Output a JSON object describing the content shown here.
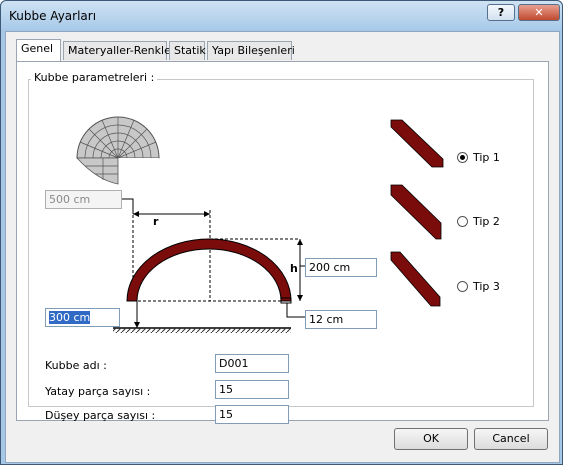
{
  "window": {
    "title": "Kubbe Ayarları",
    "help_label": "?",
    "close_label": "✕"
  },
  "tabs": [
    {
      "label": "Genel",
      "active": true
    },
    {
      "label": "Materyaller-Renkler"
    },
    {
      "label": "Statik"
    },
    {
      "label": "Yapı Bileşenleri"
    }
  ],
  "group": {
    "label": "Kubbe parametreleri :"
  },
  "fields": {
    "radius": {
      "value": "500 cm",
      "enabled": false
    },
    "base": {
      "value": "300 cm",
      "selected": true
    },
    "height": {
      "value": "200 cm"
    },
    "thickness": {
      "value": "12 cm"
    }
  },
  "diagram": {
    "radius_label": "r",
    "height_label": "h",
    "colors": {
      "dome": "#7a0c0c"
    }
  },
  "types": [
    {
      "label": "Tip 1",
      "checked": true
    },
    {
      "label": "Tip 2",
      "checked": false
    },
    {
      "label": "Tip 3",
      "checked": false
    }
  ],
  "form": {
    "name_label": "Kubbe adı :",
    "name_value": "D001",
    "horizontal_label": "Yatay parça sayısı :",
    "horizontal_value": "15",
    "vertical_label": "Düşey parça sayısı :",
    "vertical_value": "15"
  },
  "buttons": {
    "ok": "OK",
    "cancel": "Cancel"
  }
}
